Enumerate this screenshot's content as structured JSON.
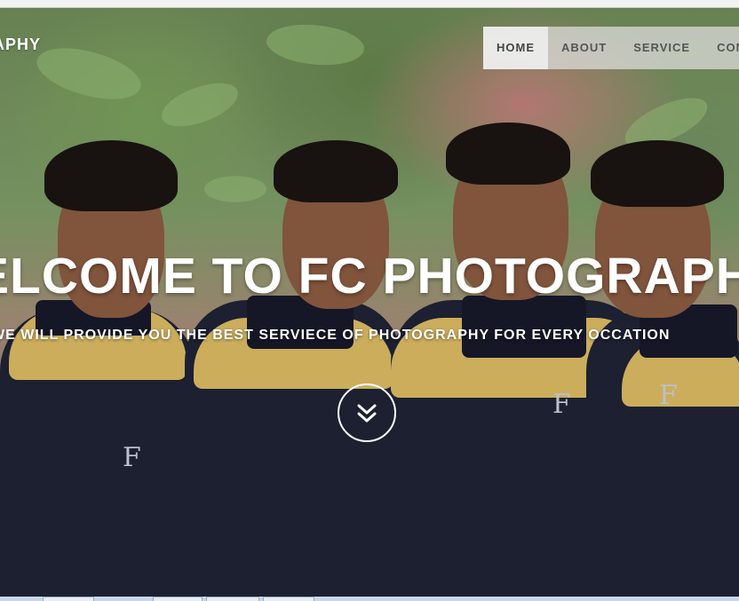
{
  "brand": {
    "text": "APHY"
  },
  "nav": {
    "items": [
      {
        "label": "HOME",
        "active": true
      },
      {
        "label": "ABOUT",
        "active": false
      },
      {
        "label": "SERVICE",
        "active": false
      },
      {
        "label": "CONT",
        "active": false
      }
    ]
  },
  "hero": {
    "headline": "ELCOME TO FC PHOTOGRAPHY",
    "subline": "WE WILL PROVIDE YOU THE BEST SERVIECE OF PHOTOGRAPHY FOR EVERY OCCATION",
    "scroll_icon": "double-chevron-down-icon"
  },
  "colors": {
    "text": "#ffffff",
    "nav_bg": "#e1e1e1",
    "nav_text": "#555555"
  }
}
